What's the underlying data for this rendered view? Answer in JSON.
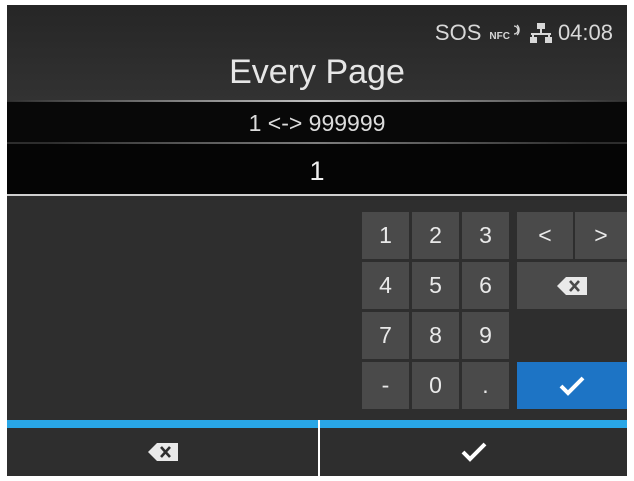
{
  "status": {
    "sos": "SOS",
    "nfc": "NFC",
    "time": "04:08"
  },
  "title": "Every Page",
  "range": "1 <-> 999999",
  "value": "1",
  "keypad": {
    "keys": [
      "1",
      "2",
      "3",
      "4",
      "5",
      "6",
      "7",
      "8",
      "9",
      "-",
      "0",
      "."
    ],
    "left_arrow": "<",
    "right_arrow": ">",
    "backspace_icon": "backspace-icon",
    "confirm_icon": "checkmark-icon"
  },
  "bottom": {
    "left_icon": "backspace-icon",
    "right_icon": "checkmark-icon"
  },
  "colors": {
    "background": "#2d2d2d",
    "key": "#4a4a4a",
    "confirm_key": "#1d74c5",
    "accent_bar": "#29a6e6",
    "text": "#e9e9e9"
  }
}
